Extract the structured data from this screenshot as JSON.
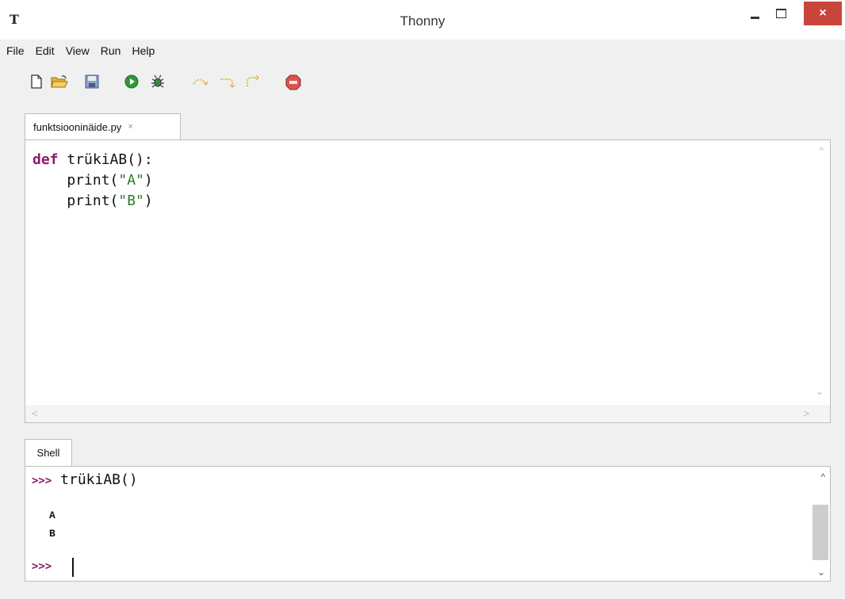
{
  "window": {
    "title": "Thonny",
    "app_icon": "T",
    "minimize_icon": "minimize-icon",
    "maximize_icon": "maximize-icon",
    "close_label": "×"
  },
  "menu": {
    "items": [
      "File",
      "Edit",
      "View",
      "Run",
      "Help"
    ]
  },
  "toolbar": {
    "icons": [
      "new-file-icon",
      "open-file-icon",
      "save-icon",
      "run-icon",
      "debug-icon",
      "step-over-icon",
      "step-into-icon",
      "step-out-icon",
      "stop-icon"
    ]
  },
  "editor": {
    "tab_label": "funktsiooninäide.py",
    "tab_close": "×",
    "code": {
      "line1_kw": "def",
      "line1_rest": " trükiAB():",
      "line2_pre": "    print(",
      "line2_str": "\"A\"",
      "line2_post": ")",
      "line3_pre": "    print(",
      "line3_str": "\"B\"",
      "line3_post": ")"
    }
  },
  "shell": {
    "tab_label": "Shell",
    "prompt": ">>>",
    "command": "trükiAB()",
    "output": [
      "A",
      "B"
    ]
  },
  "colors": {
    "keyword": "#8b1a6b",
    "string": "#2a7d2a",
    "close_button": "#c9453c"
  }
}
